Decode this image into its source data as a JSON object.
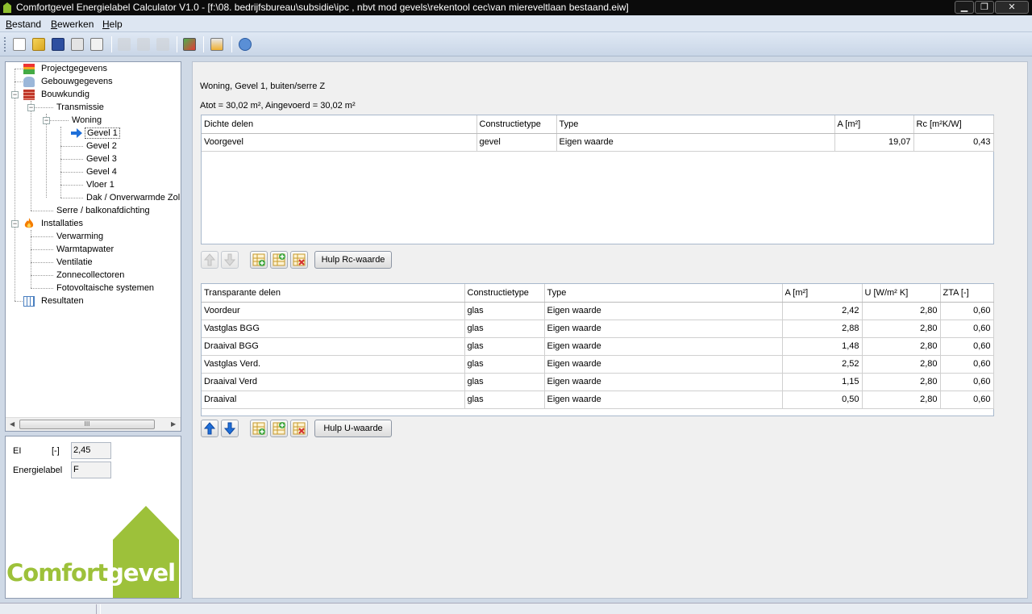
{
  "window": {
    "title": "Comfortgevel Energielabel Calculator V1.0 - [f:\\08. bedrijfsbureau\\subsidie\\ipc , nbvt mod gevels\\rekentool cec\\van miereveltlaan bestaand.eiw]",
    "controls": [
      "minimize",
      "restore",
      "close"
    ]
  },
  "menu": {
    "items": [
      "Bestand",
      "Bewerken",
      "Help"
    ]
  },
  "toolbar": {
    "icons": [
      "new-file-icon",
      "open-folder-icon",
      "save-icon",
      "print-icon",
      "print-preview-icon",
      "cut-icon",
      "copy-icon",
      "paste-icon",
      "calculate-icon",
      "epa-icon",
      "help-icon"
    ]
  },
  "tree": {
    "items": [
      {
        "label": "Projectgegevens",
        "icon": "project-icon"
      },
      {
        "label": "Gebouwgegevens",
        "icon": "building-icon"
      },
      {
        "label": "Bouwkundig",
        "icon": "bricks-icon"
      },
      {
        "label": "Transmissie"
      },
      {
        "label": "Woning"
      },
      {
        "label": "Gevel 1",
        "selected": true,
        "icon": "arrow-right-icon"
      },
      {
        "label": "Gevel 2"
      },
      {
        "label": "Gevel 3"
      },
      {
        "label": "Gevel 4"
      },
      {
        "label": "Vloer 1"
      },
      {
        "label": "Dak / Onverwarmde Zol"
      },
      {
        "label": "Serre / balkonafdichting"
      },
      {
        "label": "Installaties",
        "icon": "flame-icon"
      },
      {
        "label": "Verwarming"
      },
      {
        "label": "Warmtapwater"
      },
      {
        "label": "Ventilatie"
      },
      {
        "label": "Zonnecollectoren"
      },
      {
        "label": "Fotovoltaische systemen"
      },
      {
        "label": "Resultaten",
        "icon": "table-icon"
      }
    ],
    "scroll_thumb_glyph": "III"
  },
  "summary": {
    "ei_label": "EI",
    "ei_unit": "[-]",
    "ei_value": "2,45",
    "energielabel_label": "Energielabel",
    "energielabel_value": "F"
  },
  "logo": {
    "text_part1": "Comfort",
    "text_part2": "gevel"
  },
  "main": {
    "heading": "Woning, Gevel 1, buiten/serre Z",
    "area_line": "Atot = 30,02 m², Aingevoerd = 30,02 m²",
    "dichte": {
      "headers": [
        "Dichte delen",
        "Constructietype",
        "Type",
        "A [m²]",
        "Rc [m²K/W]"
      ],
      "rows": [
        [
          "Voorgevel",
          "gevel",
          "Eigen waarde",
          "19,07",
          "0,43"
        ]
      ],
      "help_button": "Hulp Rc-waarde"
    },
    "transparante": {
      "headers": [
        "Transparante delen",
        "Constructietype",
        "Type",
        "A [m²]",
        "U [W/m² K]",
        "ZTA [-]"
      ],
      "rows": [
        [
          "Voordeur",
          "glas",
          "Eigen waarde",
          "2,42",
          "2,80",
          "0,60"
        ],
        [
          "Vastglas BGG",
          "glas",
          "Eigen waarde",
          "2,88",
          "2,80",
          "0,60"
        ],
        [
          "Draaival BGG",
          "glas",
          "Eigen waarde",
          "1,48",
          "2,80",
          "0,60"
        ],
        [
          "Vastglas Verd.",
          "glas",
          "Eigen waarde",
          "2,52",
          "2,80",
          "0,60"
        ],
        [
          "Draaival Verd",
          "glas",
          "Eigen waarde",
          "1,15",
          "2,80",
          "0,60"
        ],
        [
          "Draaival",
          "glas",
          "Eigen waarde",
          "0,50",
          "2,80",
          "0,60"
        ]
      ],
      "help_button": "Hulp U-waarde"
    }
  },
  "colors": {
    "brand_green": "#9dc13a",
    "titlebar": "#0b0b0b",
    "arrow_blue": "#1e6fd9"
  }
}
